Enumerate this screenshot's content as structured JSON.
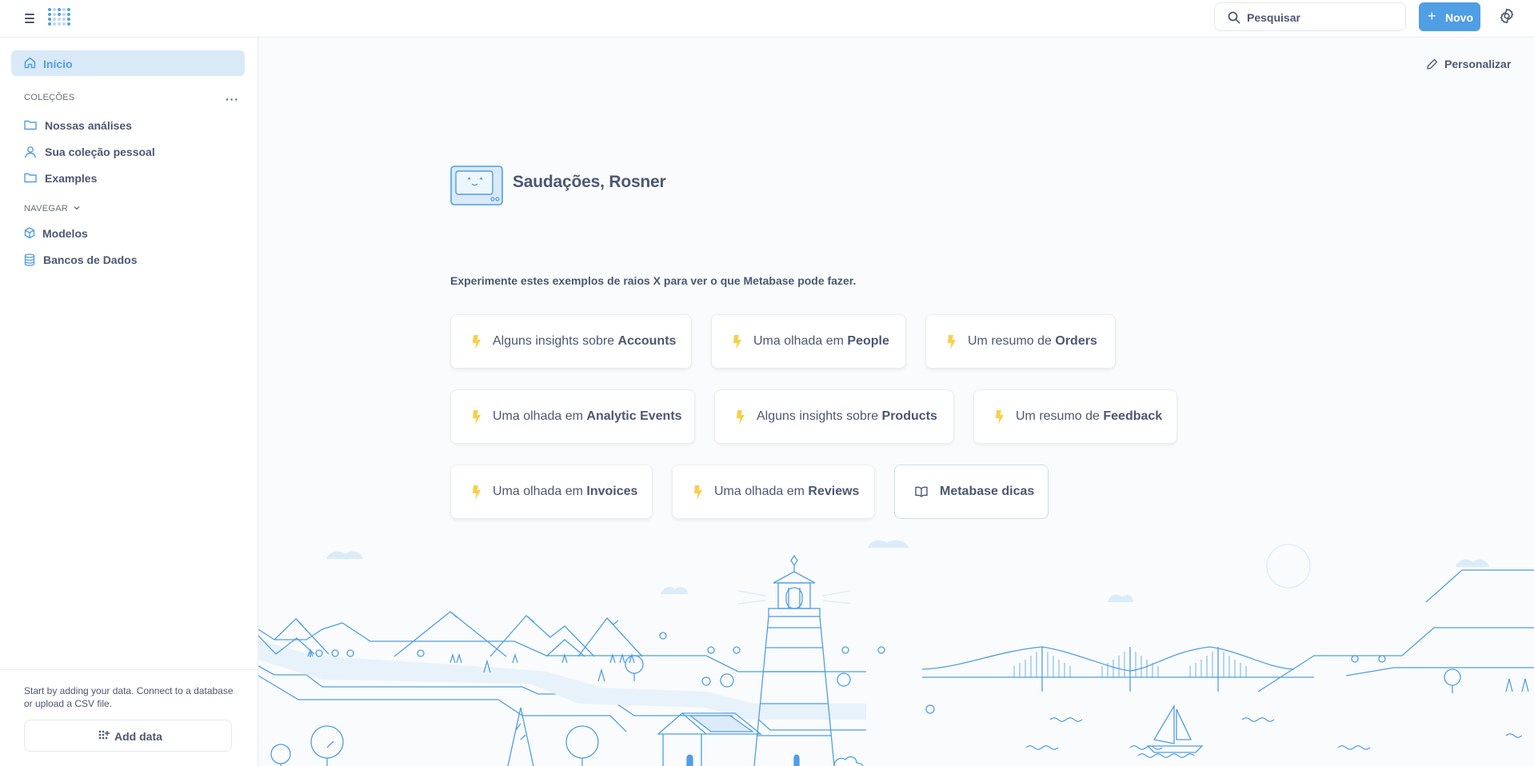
{
  "topbar": {
    "search_placeholder": "Pesquisar",
    "new_label": "Novo"
  },
  "sidebar": {
    "home_label": "Início",
    "collections_header": "COLEÇÕES",
    "collections": [
      {
        "label": "Nossas análises",
        "icon": "folder-icon"
      },
      {
        "label": "Sua coleção pessoal",
        "icon": "person-icon"
      },
      {
        "label": "Examples",
        "icon": "folder-icon"
      }
    ],
    "browse_header": "NAVEGAR",
    "browse": [
      {
        "label": "Modelos",
        "icon": "cube-icon"
      },
      {
        "label": "Bancos de Dados",
        "icon": "database-icon"
      }
    ],
    "footer_text": "Start by adding your data. Connect to a database or upload a CSV file.",
    "add_data_label": "Add data"
  },
  "main": {
    "customize_label": "Personalizar",
    "greeting": "Saudações, Rosner",
    "intro": "Experimente estes exemplos de raios X para ver o que Metabase pode fazer.",
    "xrays": [
      {
        "prefix": "Alguns insights sobre ",
        "table": "Accounts"
      },
      {
        "prefix": "Uma olhada em ",
        "table": "People"
      },
      {
        "prefix": "Um resumo de ",
        "table": "Orders"
      },
      {
        "prefix": "Uma olhada em ",
        "table": "Analytic Events"
      },
      {
        "prefix": "Alguns insights sobre ",
        "table": "Products"
      },
      {
        "prefix": "Um resumo de ",
        "table": "Feedback"
      },
      {
        "prefix": "Uma olhada em ",
        "table": "Invoices"
      },
      {
        "prefix": "Uma olhada em ",
        "table": "Reviews"
      }
    ],
    "tips_label": "Metabase dicas"
  },
  "colors": {
    "brand": "#509ee3",
    "text": "#4c5773",
    "bolt": "#f9cf48",
    "home_bg": "#d9e9f8"
  }
}
